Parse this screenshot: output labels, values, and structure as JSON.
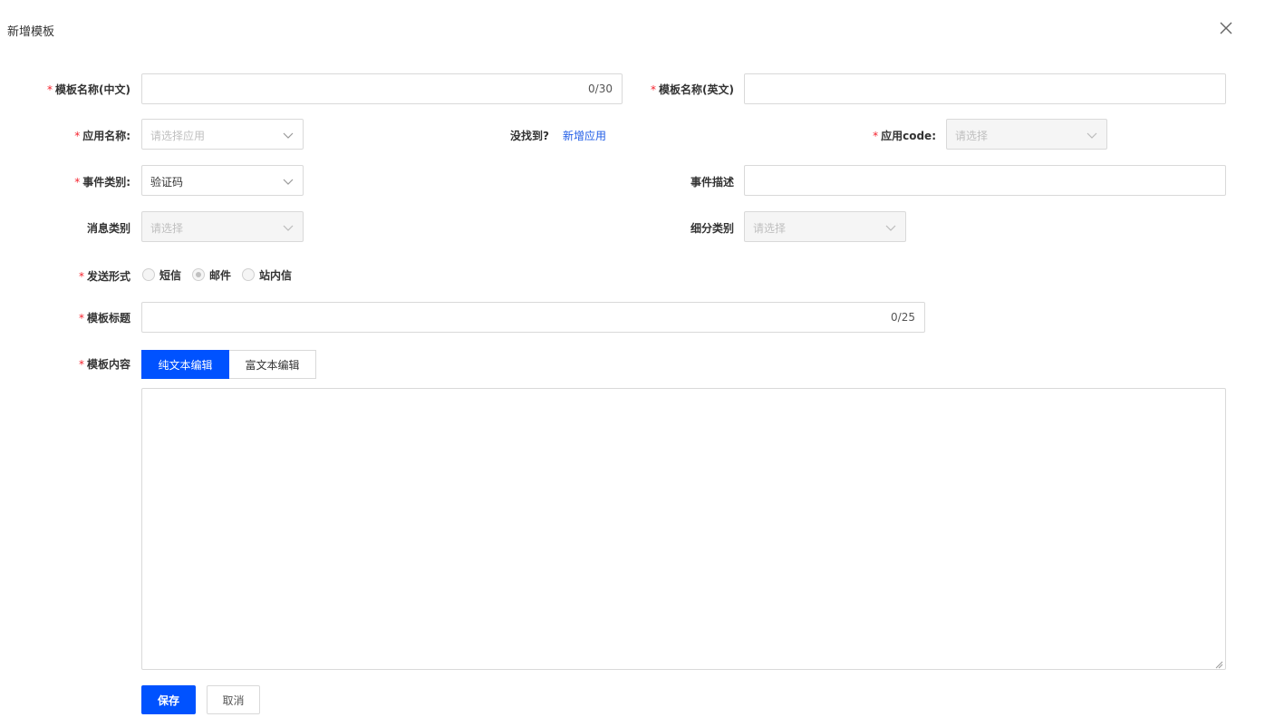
{
  "dialog": {
    "title": "新增模板",
    "close_icon": "close-icon"
  },
  "form": {
    "name_cn": {
      "label": "模板名称(中文)",
      "required": "*",
      "value": "",
      "counter": "0/30"
    },
    "name_en": {
      "label": "模板名称(英文)",
      "required": "*",
      "value": ""
    },
    "app_name": {
      "label": "应用名称:",
      "required": "*",
      "placeholder": "请选择应用",
      "not_found_text": "没找到?",
      "add_link": "新增应用"
    },
    "app_code": {
      "label": "应用code:",
      "required": "*",
      "placeholder": "请选择"
    },
    "event_type": {
      "label": "事件类别:",
      "required": "*",
      "value": "验证码"
    },
    "event_desc": {
      "label": "事件描述",
      "value": ""
    },
    "message_type": {
      "label": "消息类别",
      "placeholder": "请选择"
    },
    "sub_type": {
      "label": "细分类别",
      "placeholder": "请选择"
    },
    "send_form": {
      "label": "发送形式",
      "required": "*",
      "options": [
        "短信",
        "邮件",
        "站内信"
      ],
      "selected": "邮件"
    },
    "template_title": {
      "label": "模板标题",
      "required": "*",
      "value": "",
      "counter": "0/25"
    },
    "template_content": {
      "label": "模板内容",
      "required": "*",
      "tabs": [
        "纯文本编辑",
        "富文本编辑"
      ],
      "active_tab": "纯文本编辑",
      "value": ""
    }
  },
  "actions": {
    "save_label": "保存",
    "cancel_label": "取消"
  },
  "colors": {
    "primary": "#0052ff",
    "link": "#1f5ce6",
    "required": "#f5222d",
    "border": "#d9d9d9"
  }
}
